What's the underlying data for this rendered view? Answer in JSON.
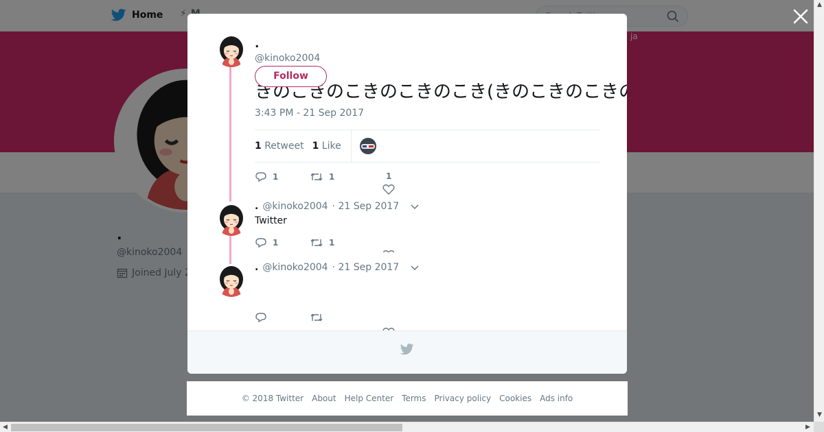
{
  "background_page": {
    "nav": {
      "home_label": "Home",
      "moments_label": "M",
      "search_placeholder": "Search Twitter",
      "lang_label": "ja"
    },
    "profile": {
      "name": ".",
      "handle": "@kinoko2004",
      "joined": "Joined July 2"
    }
  },
  "modal": {
    "main_tweet": {
      "name": ".",
      "handle": "@kinoko2004",
      "follow_label": "Follow",
      "text": "きのこきのこきのこきのこき(きのこきのこきの)きのこきのこきのこきのこきのこきのこきのこきのこきのこきのこ",
      "time": "3:43 PM - 21 Sep 2017",
      "retweet_count": "1",
      "retweet_label": "Retweet",
      "like_count": "1",
      "like_label": "Like",
      "reply_count": "1",
      "action_retweet_count": "1",
      "action_like_count": "1"
    },
    "replies": [
      {
        "name": ".",
        "handle": "@kinoko2004",
        "date": "· 21 Sep 2017",
        "text": "Twitter",
        "reply_count": "1",
        "retweet_count": "1"
      },
      {
        "name": ".",
        "handle": "@kinoko2004",
        "date": "· 21 Sep 2017",
        "text": "",
        "reply_count": "",
        "retweet_count": ""
      }
    ]
  },
  "footer": {
    "links": [
      "© 2018 Twitter",
      "About",
      "Help Center",
      "Terms",
      "Privacy policy",
      "Cookies",
      "Ads info"
    ]
  },
  "colors": {
    "accent": "#b42b61",
    "banner": "#d62d6c",
    "thread": "#f5a9c4",
    "twitter_blue": "#1da1f2"
  }
}
